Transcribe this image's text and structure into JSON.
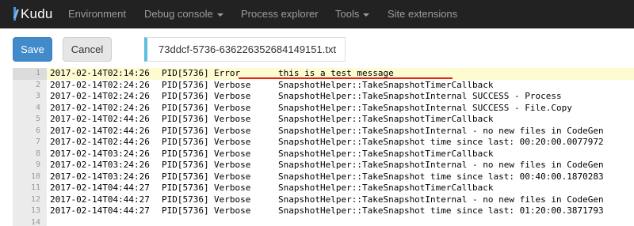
{
  "navbar": {
    "brand": "Kudu",
    "items": [
      {
        "label": "Environment",
        "dropdown": false
      },
      {
        "label": "Debug console",
        "dropdown": true
      },
      {
        "label": "Process explorer",
        "dropdown": false
      },
      {
        "label": "Tools",
        "dropdown": true
      },
      {
        "label": "Site extensions",
        "dropdown": false
      }
    ]
  },
  "toolbar": {
    "save_label": "Save",
    "cancel_label": "Cancel",
    "filename": "73ddcf-5736-636226352684149151.txt"
  },
  "editor": {
    "active_line": 1,
    "lines": [
      {
        "n": "1",
        "ts": "2017-02-14T02:14:26",
        "pid": "PID[5736]",
        "level": "Error",
        "msg": "this is a test message"
      },
      {
        "n": "2",
        "ts": "2017-02-14T02:24:26",
        "pid": "PID[5736]",
        "level": "Verbose",
        "msg": "SnapshotHelper::TakeSnapshotTimerCallback"
      },
      {
        "n": "3",
        "ts": "2017-02-14T02:24:26",
        "pid": "PID[5736]",
        "level": "Verbose",
        "msg": "SnapshotHelper::TakeSnapshotInternal SUCCESS - Process"
      },
      {
        "n": "4",
        "ts": "2017-02-14T02:24:26",
        "pid": "PID[5736]",
        "level": "Verbose",
        "msg": "SnapshotHelper::TakeSnapshotInternal SUCCESS - File.Copy"
      },
      {
        "n": "5",
        "ts": "2017-02-14T02:44:26",
        "pid": "PID[5736]",
        "level": "Verbose",
        "msg": "SnapshotHelper::TakeSnapshotTimerCallback"
      },
      {
        "n": "6",
        "ts": "2017-02-14T02:44:26",
        "pid": "PID[5736]",
        "level": "Verbose",
        "msg": "SnapshotHelper::TakeSnapshotInternal - no new files in CodeGen"
      },
      {
        "n": "7",
        "ts": "2017-02-14T02:44:26",
        "pid": "PID[5736]",
        "level": "Verbose",
        "msg": "SnapshotHelper::TakeSnapshot time since last: 00:20:00.0077972"
      },
      {
        "n": "8",
        "ts": "2017-02-14T03:24:26",
        "pid": "PID[5736]",
        "level": "Verbose",
        "msg": "SnapshotHelper::TakeSnapshotTimerCallback"
      },
      {
        "n": "9",
        "ts": "2017-02-14T03:24:26",
        "pid": "PID[5736]",
        "level": "Verbose",
        "msg": "SnapshotHelper::TakeSnapshotInternal - no new files in CodeGen"
      },
      {
        "n": "10",
        "ts": "2017-02-14T03:24:26",
        "pid": "PID[5736]",
        "level": "Verbose",
        "msg": "SnapshotHelper::TakeSnapshot time since last: 00:40:00.1870283"
      },
      {
        "n": "11",
        "ts": "2017-02-14T04:44:27",
        "pid": "PID[5736]",
        "level": "Verbose",
        "msg": "SnapshotHelper::TakeSnapshotTimerCallback"
      },
      {
        "n": "12",
        "ts": "2017-02-14T04:44:27",
        "pid": "PID[5736]",
        "level": "Verbose",
        "msg": "SnapshotHelper::TakeSnapshotInternal - no new files in CodeGen"
      },
      {
        "n": "13",
        "ts": "2017-02-14T04:44:27",
        "pid": "PID[5736]",
        "level": "Verbose",
        "msg": "SnapshotHelper::TakeSnapshot time since last: 01:20:00.3871793"
      },
      {
        "n": "14",
        "ts": "",
        "pid": "",
        "level": "",
        "msg": ""
      }
    ]
  },
  "colors": {
    "navbar_bg": "#222222",
    "save_button": "#428bca",
    "active_line_bg": "#fffbd1",
    "annotation_underline": "#d9262b"
  }
}
